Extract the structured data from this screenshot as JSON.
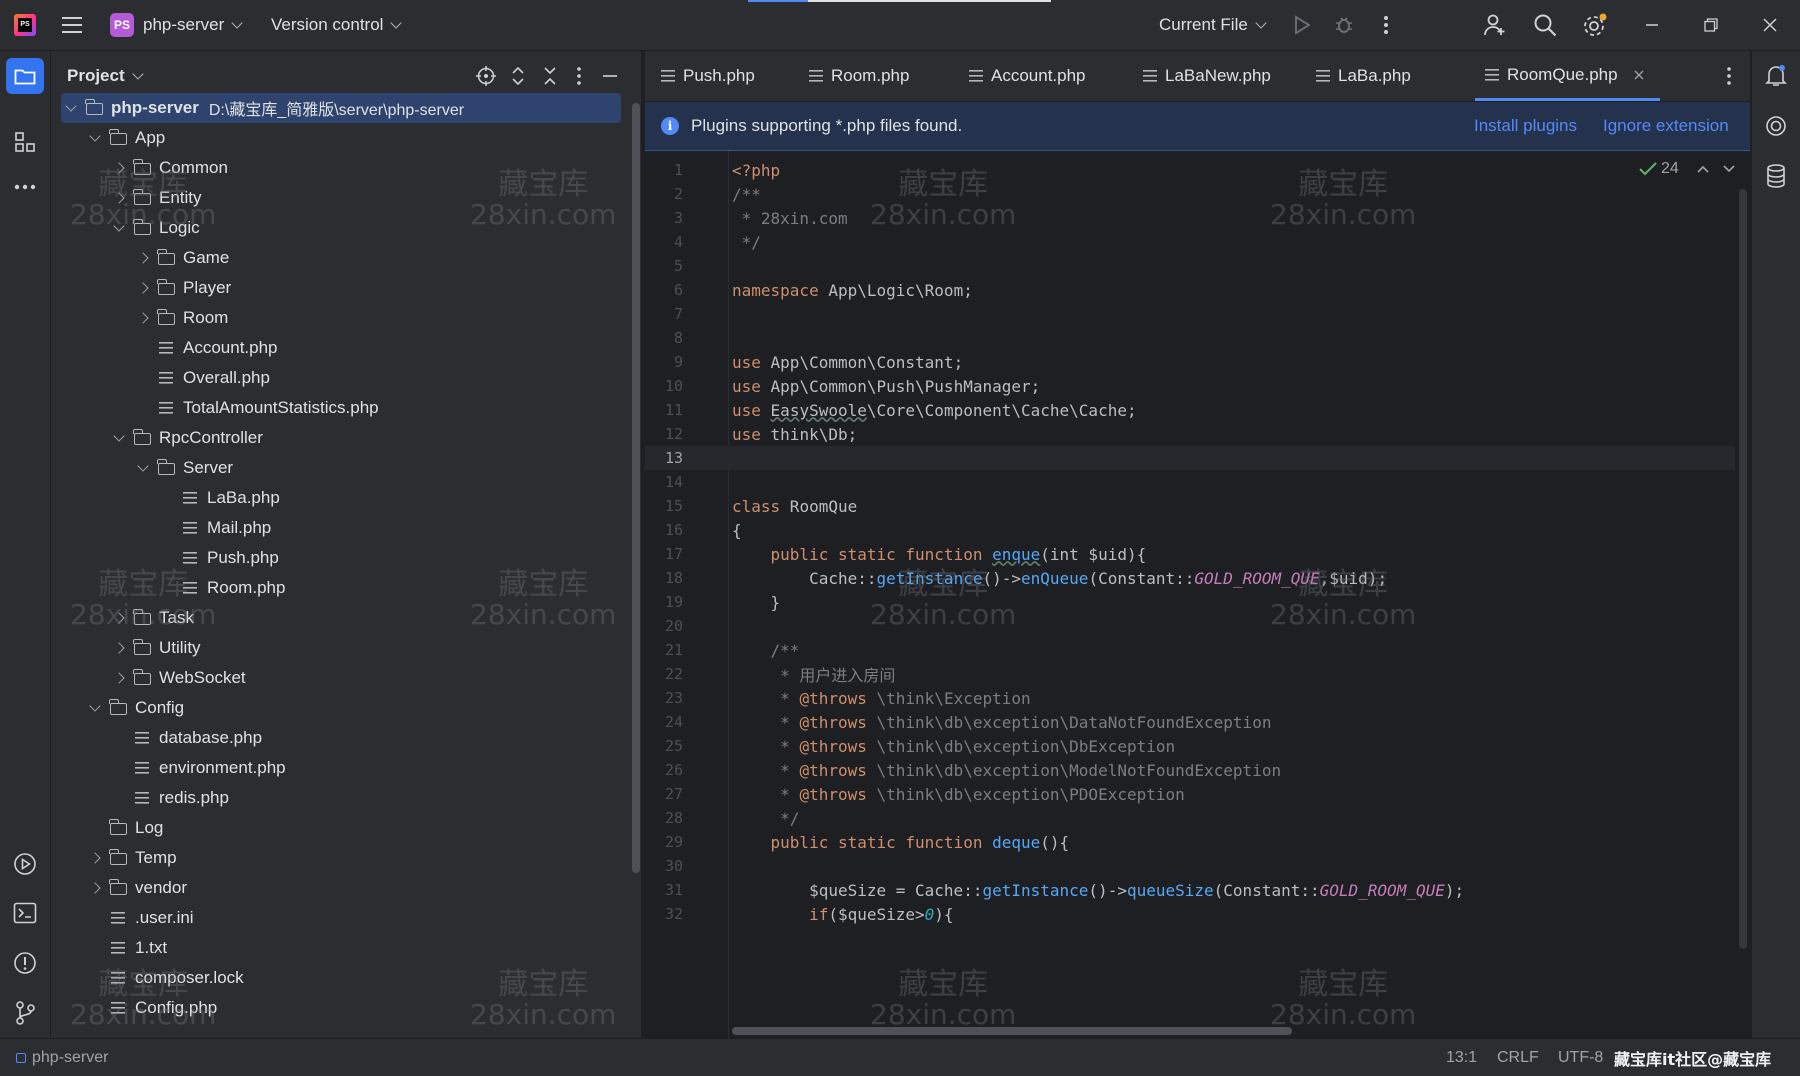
{
  "titlebar": {
    "project_badge": "PS",
    "project_name": "php-server",
    "version_control": "Version control",
    "run_config": "Current File"
  },
  "project_panel": {
    "title": "Project",
    "tree": [
      {
        "label": "php-server",
        "path": "D:\\藏宝库_简雅版\\server\\php-server",
        "type": "folder",
        "depth": 0,
        "arrow": "down",
        "selected": true
      },
      {
        "label": "App",
        "type": "folder",
        "depth": 1,
        "arrow": "down"
      },
      {
        "label": "Common",
        "type": "folder",
        "depth": 2,
        "arrow": "right"
      },
      {
        "label": "Entity",
        "type": "folder",
        "depth": 2,
        "arrow": "right"
      },
      {
        "label": "Logic",
        "type": "folder",
        "depth": 2,
        "arrow": "down"
      },
      {
        "label": "Game",
        "type": "folder",
        "depth": 3,
        "arrow": "right"
      },
      {
        "label": "Player",
        "type": "folder",
        "depth": 3,
        "arrow": "right"
      },
      {
        "label": "Room",
        "type": "folder",
        "depth": 3,
        "arrow": "right"
      },
      {
        "label": "Account.php",
        "type": "file",
        "depth": 3
      },
      {
        "label": "Overall.php",
        "type": "file",
        "depth": 3
      },
      {
        "label": "TotalAmountStatistics.php",
        "type": "file",
        "depth": 3
      },
      {
        "label": "RpcController",
        "type": "folder",
        "depth": 2,
        "arrow": "down"
      },
      {
        "label": "Server",
        "type": "folder",
        "depth": 3,
        "arrow": "down"
      },
      {
        "label": "LaBa.php",
        "type": "file",
        "depth": 4
      },
      {
        "label": "Mail.php",
        "type": "file",
        "depth": 4
      },
      {
        "label": "Push.php",
        "type": "file",
        "depth": 4
      },
      {
        "label": "Room.php",
        "type": "file",
        "depth": 4
      },
      {
        "label": "Task",
        "type": "folder",
        "depth": 2,
        "arrow": "right"
      },
      {
        "label": "Utility",
        "type": "folder",
        "depth": 2,
        "arrow": "right"
      },
      {
        "label": "WebSocket",
        "type": "folder",
        "depth": 2,
        "arrow": "right"
      },
      {
        "label": "Config",
        "type": "folder",
        "depth": 1,
        "arrow": "down"
      },
      {
        "label": "database.php",
        "type": "file",
        "depth": 2
      },
      {
        "label": "environment.php",
        "type": "file",
        "depth": 2
      },
      {
        "label": "redis.php",
        "type": "file",
        "depth": 2
      },
      {
        "label": "Log",
        "type": "folder",
        "depth": 1
      },
      {
        "label": "Temp",
        "type": "folder",
        "depth": 1,
        "arrow": "right"
      },
      {
        "label": "vendor",
        "type": "folder",
        "depth": 1,
        "arrow": "right"
      },
      {
        "label": ".user.ini",
        "type": "file",
        "depth": 1
      },
      {
        "label": "1.txt",
        "type": "file",
        "depth": 1
      },
      {
        "label": "composer.lock",
        "type": "file",
        "depth": 1
      },
      {
        "label": "Config.php",
        "type": "file",
        "depth": 1
      }
    ]
  },
  "tabs": [
    {
      "label": "Push.php"
    },
    {
      "label": "Room.php"
    },
    {
      "label": "Account.php"
    },
    {
      "label": "LaBaNew.php"
    },
    {
      "label": "LaBa.php"
    },
    {
      "label": "RoomQue.php",
      "active": true
    }
  ],
  "notification": {
    "message": "Plugins supporting *.php files found.",
    "install": "Install plugins",
    "ignore": "Ignore extension"
  },
  "inspections": {
    "count": "24"
  },
  "code": [
    "<?php",
    "/**",
    " * 28xin.com",
    " */",
    "",
    "namespace App\\Logic\\Room;",
    "",
    "",
    "use App\\Common\\Constant;",
    "use App\\Common\\Push\\PushManager;",
    "use EasySwoole\\Core\\Component\\Cache\\Cache;",
    "use think\\Db;",
    "",
    "",
    "class RoomQue",
    "{",
    "    public static function enque(int $uid){",
    "        Cache::getInstance()->enQueue(Constant::GOLD_ROOM_QUE,$uid);",
    "    }",
    "",
    "    /**",
    "     * 用户进入房间",
    "     * @throws \\think\\Exception",
    "     * @throws \\think\\db\\exception\\DataNotFoundException",
    "     * @throws \\think\\db\\exception\\DbException",
    "     * @throws \\think\\db\\exception\\ModelNotFoundException",
    "     * @throws \\think\\db\\exception\\PDOException",
    "     */",
    "    public static function deque(){",
    "",
    "        $queSize = Cache::getInstance()->queueSize(Constant::GOLD_ROOM_QUE);",
    "        if($queSize>0){"
  ],
  "current_line": 13,
  "statusbar": {
    "project": "php-server",
    "position": "13:1",
    "line_sep": "CRLF",
    "encoding": "UTF-8",
    "watermark_text": "藏宝库it社区@藏宝库"
  },
  "watermark": {
    "line1": "藏宝库",
    "line2": "28xin.com"
  }
}
